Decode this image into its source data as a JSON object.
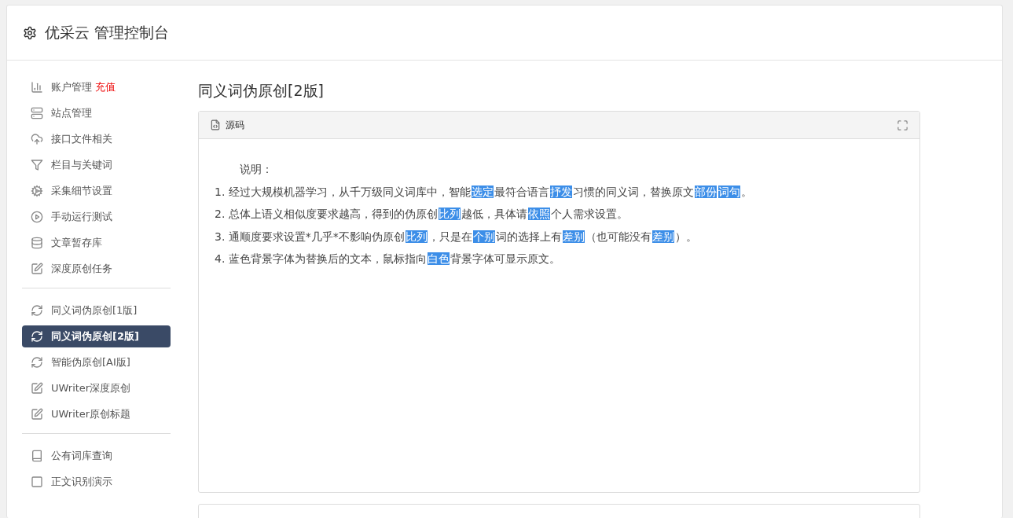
{
  "header": {
    "title": "优采云 管理控制台"
  },
  "sidebar": {
    "groups": [
      {
        "items": [
          {
            "label": "账户管理",
            "badge": "充值",
            "selected": false
          },
          {
            "label": "站点管理",
            "selected": false
          },
          {
            "label": "接口文件相关",
            "selected": false
          },
          {
            "label": "栏目与关键词",
            "selected": false
          },
          {
            "label": "采集细节设置",
            "selected": false
          },
          {
            "label": "手动运行测试",
            "selected": false
          },
          {
            "label": "文章暂存库",
            "selected": false
          },
          {
            "label": "深度原创任务",
            "selected": false
          }
        ]
      },
      {
        "items": [
          {
            "label": "同义词伪原创[1版]",
            "selected": false
          },
          {
            "label": "同义词伪原创[2版]",
            "selected": true
          },
          {
            "label": "智能伪原创[AI版]",
            "selected": false
          },
          {
            "label": "UWriter深度原创",
            "selected": false
          },
          {
            "label": "UWriter原创标题",
            "selected": false
          }
        ]
      },
      {
        "items": [
          {
            "label": "公有词库查询",
            "selected": false
          },
          {
            "label": "正文识别演示",
            "selected": false
          }
        ]
      }
    ]
  },
  "main": {
    "title": "同义词伪原创[2版]",
    "panel": {
      "tab": "源码",
      "heading": "说明：",
      "lines": [
        [
          {
            "text": "1. 经过大规模机器学习，从千万级同义词库中，智能",
            "highlighted": false
          },
          {
            "text": "选定",
            "highlighted": true
          },
          {
            "text": "最符合语言",
            "highlighted": false
          },
          {
            "text": "抒发",
            "highlighted": true
          },
          {
            "text": "习惯的同义词，替换原文",
            "highlighted": false
          },
          {
            "text": "部份",
            "highlighted": true
          },
          {
            "text": "词句",
            "highlighted": true
          },
          {
            "text": "。",
            "highlighted": false
          }
        ],
        [
          {
            "text": "2. 总体上语义相似度要求越高，得到的伪原创",
            "highlighted": false
          },
          {
            "text": "比列",
            "highlighted": true
          },
          {
            "text": "越低，具体请",
            "highlighted": false
          },
          {
            "text": "依照",
            "highlighted": true
          },
          {
            "text": "个人需求设置。",
            "highlighted": false
          }
        ],
        [
          {
            "text": "3. 通顺度要求设置*几乎*不影响伪原创",
            "highlighted": false
          },
          {
            "text": "比列",
            "highlighted": true
          },
          {
            "text": "，只是在",
            "highlighted": false
          },
          {
            "text": "个别",
            "highlighted": true
          },
          {
            "text": "词的选择上有",
            "highlighted": false
          },
          {
            "text": "差别",
            "highlighted": true
          },
          {
            "text": "（也可能没有",
            "highlighted": false
          },
          {
            "text": "差别",
            "highlighted": true
          },
          {
            "text": "）。",
            "highlighted": false
          }
        ],
        [
          {
            "text": "4. 蓝色背景字体为替换后的文本，鼠标指向",
            "highlighted": false
          },
          {
            "text": "白色",
            "highlighted": true
          },
          {
            "text": "背景字体可显示原文。",
            "highlighted": false
          }
        ]
      ]
    }
  }
}
